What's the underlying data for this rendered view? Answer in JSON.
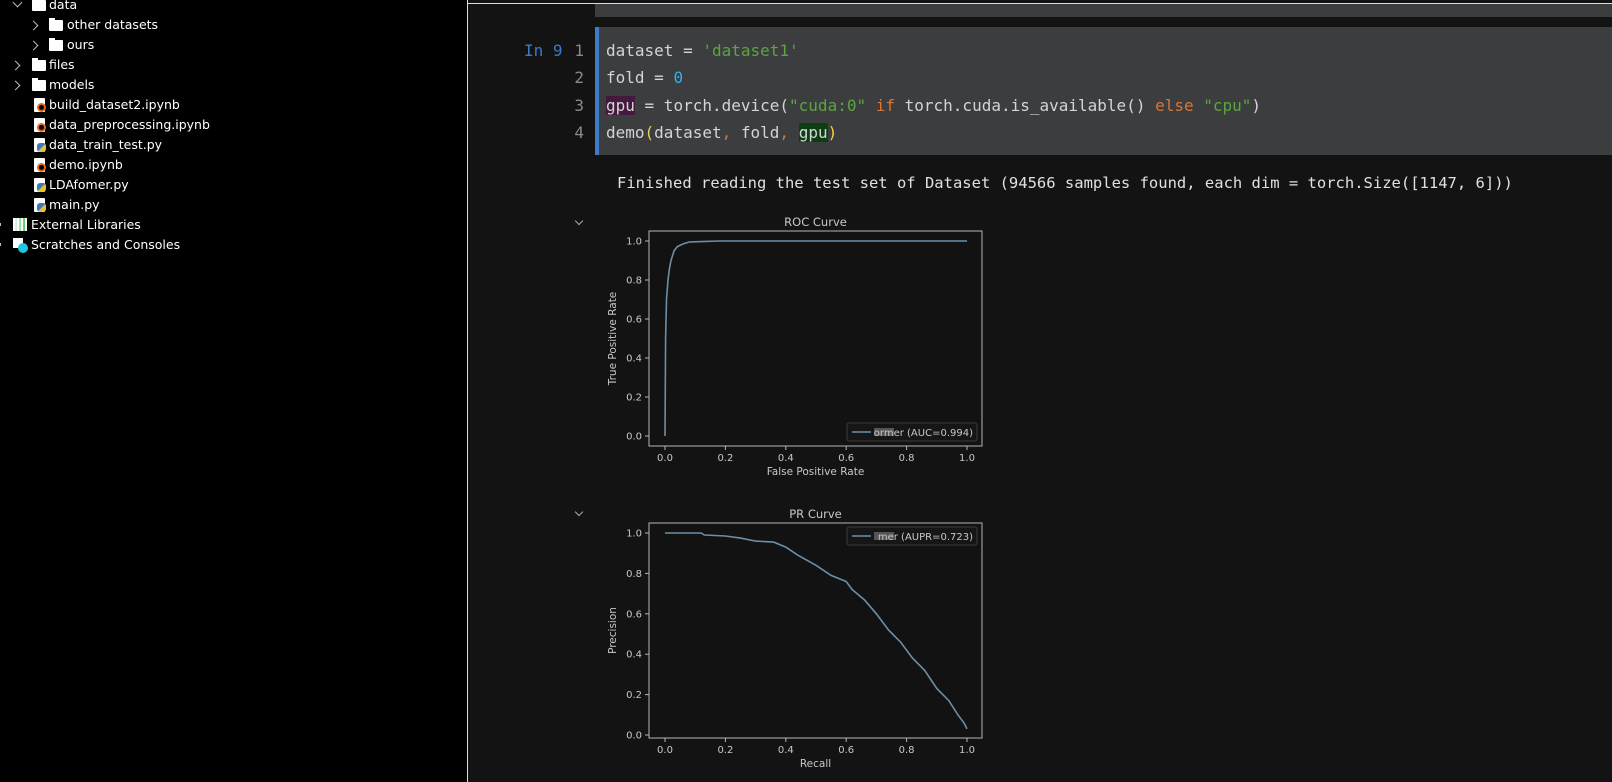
{
  "sidebar": {
    "items": [
      {
        "label": "data",
        "type": "folder",
        "expanded": true
      },
      {
        "label": "other datasets",
        "type": "folder",
        "expanded": false
      },
      {
        "label": "ours",
        "type": "folder",
        "expanded": false
      },
      {
        "label": "files",
        "type": "folder",
        "expanded": false
      },
      {
        "label": "models",
        "type": "folder",
        "expanded": false
      },
      {
        "label": "build_dataset2.ipynb",
        "type": "notebook"
      },
      {
        "label": "data_preprocessing.ipynb",
        "type": "notebook"
      },
      {
        "label": "data_train_test.py",
        "type": "python"
      },
      {
        "label": "demo.ipynb",
        "type": "notebook"
      },
      {
        "label": "LDAfomer.py",
        "type": "python"
      },
      {
        "label": "main.py",
        "type": "python"
      },
      {
        "label": "External Libraries",
        "type": "library-icon"
      },
      {
        "label": "Scratches and Consoles",
        "type": "scratches-icon"
      }
    ]
  },
  "cell": {
    "prompt": "In 9",
    "line_numbers": [
      "1",
      "2",
      "3",
      "4"
    ],
    "lines": {
      "l1a": "dataset = ",
      "l1b": "'dataset1'",
      "l2a": "fold = ",
      "l2b": "0",
      "l3a": "gpu",
      "l3b": " = torch.device(",
      "l3c": "\"cuda:0\"",
      "l3d": " if",
      "l3e": " torch.cuda.is_available() ",
      "l3f": "else",
      "l3g": " \"cpu\"",
      "l3h": ")",
      "l4a": "demo",
      "l4b": "(",
      "l4c": "dataset",
      "l4d": ",",
      "l4e": " fold",
      "l4f": ",",
      "l4g": " ",
      "l4h": "gpu",
      "l4i": ")"
    }
  },
  "output": {
    "text": "Finished reading the test set of Dataset (94566 samples found, each dim = torch.Size([1147, 6]))"
  },
  "colors": {
    "accent": "#3d7ac7",
    "curve": "#6b8fa8",
    "string": "#5aa63e",
    "keyword": "#d9753a",
    "number": "#2fb4e8"
  },
  "chart_data": [
    {
      "type": "line",
      "title": "ROC Curve",
      "xlabel": "False Positive Rate",
      "ylabel": "True Positive Rate",
      "xlim": [
        0,
        1
      ],
      "ylim": [
        0,
        1
      ],
      "xticks": [
        "0.0",
        "0.2",
        "0.4",
        "0.6",
        "0.8",
        "1.0"
      ],
      "yticks": [
        "0.0",
        "0.2",
        "0.4",
        "0.6",
        "0.8",
        "1.0"
      ],
      "legend_position": "lower right",
      "series": [
        {
          "name": "ormer (AUC=0.994)",
          "x": [
            0,
            0.002,
            0.005,
            0.01,
            0.015,
            0.02,
            0.03,
            0.04,
            0.06,
            0.08,
            0.12,
            0.18,
            1.0
          ],
          "y": [
            0,
            0.5,
            0.7,
            0.8,
            0.86,
            0.9,
            0.95,
            0.97,
            0.985,
            0.995,
            0.997,
            1.0,
            1.0
          ]
        }
      ]
    },
    {
      "type": "line",
      "title": "PR Curve",
      "xlabel": "Recall",
      "ylabel": "Precision",
      "xlim": [
        0,
        1
      ],
      "ylim": [
        0,
        1
      ],
      "xticks": [
        "0.0",
        "0.2",
        "0.4",
        "0.6",
        "0.8",
        "1.0"
      ],
      "yticks": [
        "0.0",
        "0.2",
        "0.4",
        "0.6",
        "0.8",
        "1.0"
      ],
      "legend_position": "upper right",
      "series": [
        {
          "name": "mer (AUPR=0.723)",
          "x": [
            0,
            0.12,
            0.13,
            0.2,
            0.25,
            0.3,
            0.36,
            0.4,
            0.44,
            0.5,
            0.55,
            0.6,
            0.62,
            0.66,
            0.7,
            0.74,
            0.78,
            0.82,
            0.86,
            0.9,
            0.94,
            0.97,
            0.99,
            1.0
          ],
          "y": [
            1,
            1,
            0.99,
            0.985,
            0.975,
            0.96,
            0.955,
            0.93,
            0.89,
            0.84,
            0.79,
            0.76,
            0.72,
            0.67,
            0.6,
            0.52,
            0.46,
            0.38,
            0.32,
            0.23,
            0.17,
            0.1,
            0.06,
            0.03
          ]
        }
      ]
    }
  ]
}
